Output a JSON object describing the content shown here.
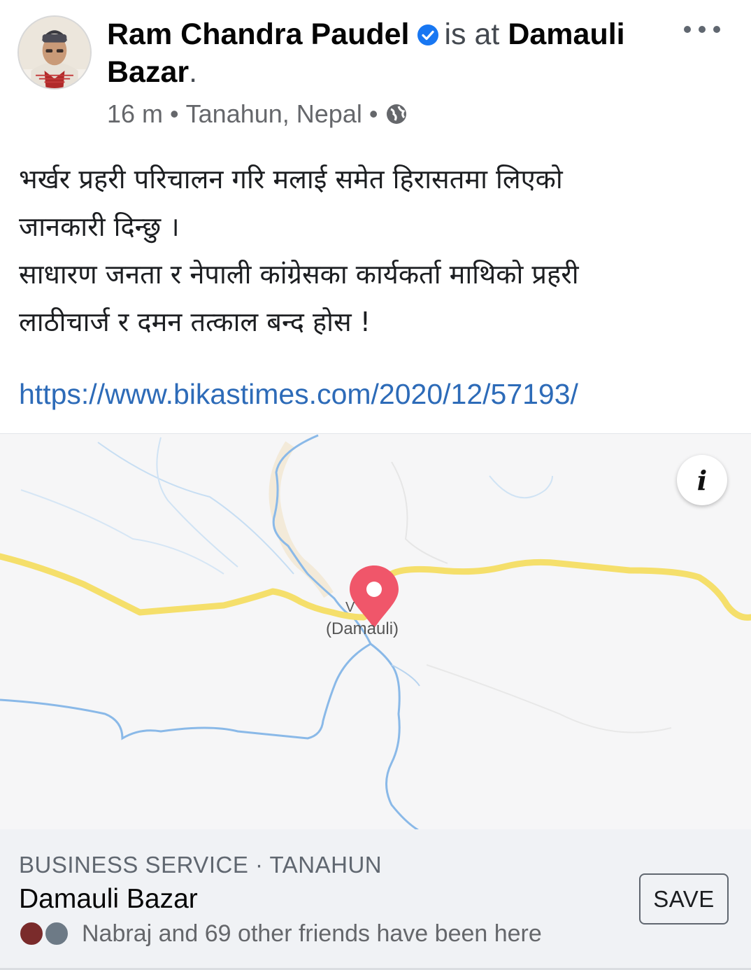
{
  "post": {
    "author": "Ram Chandra Paudel",
    "verified": true,
    "is_at": "is at",
    "place": "Damauli Bazar",
    "place_suffix": ".",
    "time": "16 m",
    "location": "Tanahun, Nepal",
    "separator": "•",
    "privacy_icon": "globe-icon",
    "text_lines": [
      "भर्खर प्रहरी परिचालन गरि मलाई समेत हिरासतमा लिएको",
      "जानकारी दिन्छु ।",
      "साधारण जनता र नेपाली कांग्रेसका कार्यकर्ता माथिको प्रहरी",
      "लाठीचार्ज र दमन तत्काल बन्द होस !"
    ],
    "link": "https://www.bikastimes.com/2020/12/57193/"
  },
  "map": {
    "label_short": "V",
    "label": "(Damauli)",
    "info_icon": "i",
    "colors": {
      "road": "#f5df6b",
      "river": "#8ab9e8",
      "pin": "#f0566a",
      "background": "#f6f6f7"
    }
  },
  "place_card": {
    "category": "BUSINESS SERVICE · TANAHUN",
    "name": "Damauli Bazar",
    "friends_text": "Nabraj and 69 other friends have been here",
    "save_label": "SAVE"
  },
  "colors": {
    "verified": "#1877f2",
    "link": "#2d6bb8",
    "card_bg": "#f0f2f5"
  }
}
